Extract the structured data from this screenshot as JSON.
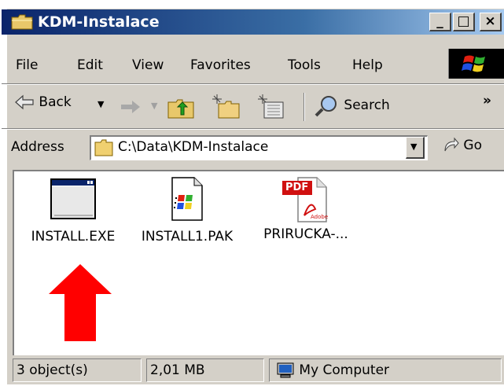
{
  "window": {
    "title": "KDM-Instalace",
    "controls": {
      "minimize": "_",
      "maximize": "□",
      "close": "×"
    }
  },
  "menubar": {
    "items": [
      "File",
      "Edit",
      "View",
      "Favorites",
      "Tools",
      "Help"
    ]
  },
  "toolbar": {
    "back_label": "Back",
    "search_label": "Search",
    "overflow_label": "»"
  },
  "address": {
    "label": "Address",
    "value": "C:\\Data\\KDM-Instalace",
    "go_label": "Go"
  },
  "files": [
    {
      "name": "INSTALL.EXE",
      "icon": "application-window-icon"
    },
    {
      "name": "INSTALL1.PAK",
      "icon": "windows-file-icon"
    },
    {
      "name": "PRIRUCKA-...",
      "icon": "pdf-document-icon",
      "badge": "PDF",
      "brand": "Adobe"
    }
  ],
  "annotation": {
    "icon": "red-up-arrow",
    "color": "#ff0000"
  },
  "statusbar": {
    "objects": "3 object(s)",
    "size": "2,01 MB",
    "zone": "My Computer"
  },
  "colors": {
    "titlebar_start": "#0a246a",
    "titlebar_end": "#a6caf0",
    "chrome": "#d4d0c8",
    "arrow": "#ff0000"
  }
}
